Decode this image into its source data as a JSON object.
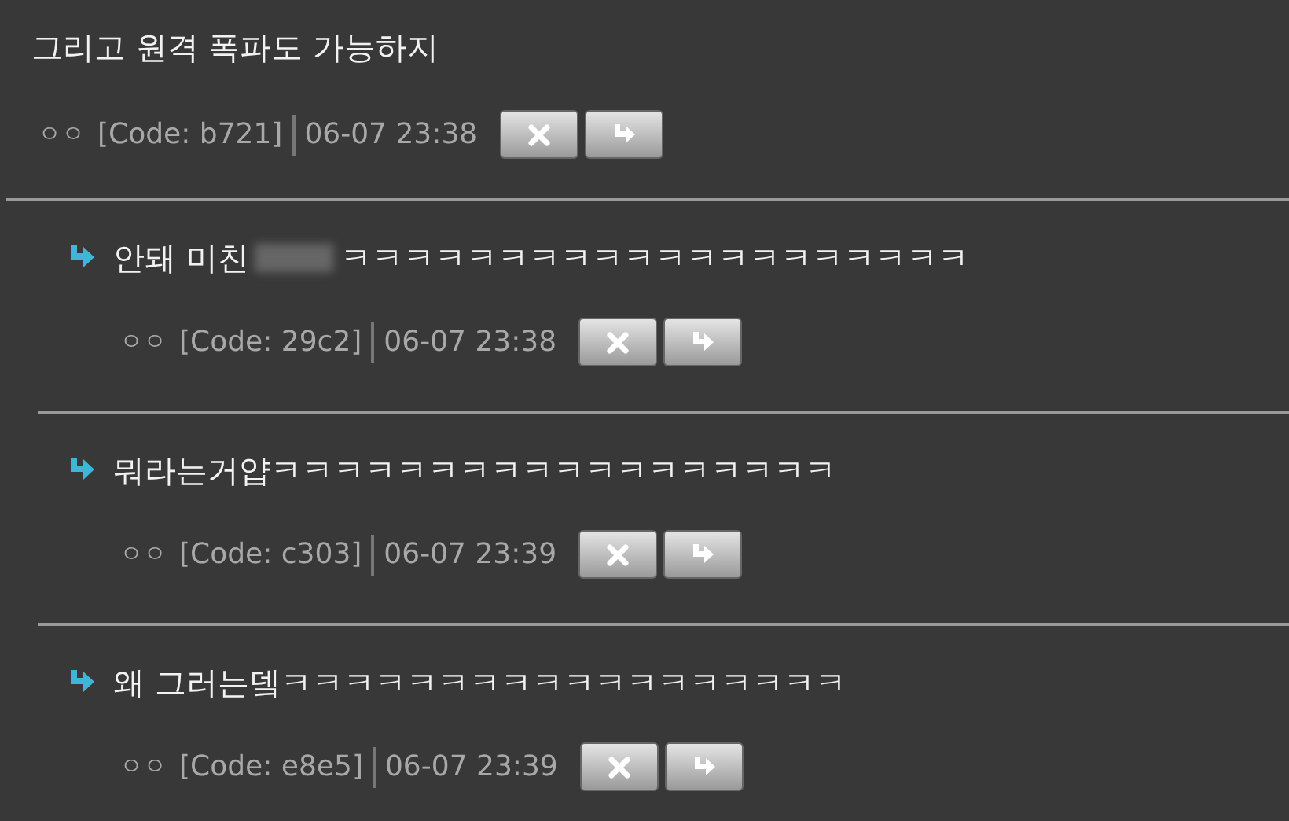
{
  "comment": {
    "text": "그리고 원격 폭파도 가능하지",
    "author": "ㅇㅇ",
    "code": "[Code: b721]",
    "time": "06-07 23:38"
  },
  "replies": [
    {
      "text_before": "안돼 미친",
      "censored": true,
      "text_after": "ㅋㅋㅋㅋㅋㅋㅋㅋㅋㅋㅋㅋㅋㅋㅋㅋㅋㅋㅋㅋ",
      "author": "ㅇㅇ",
      "code": "[Code: 29c2]",
      "time": "06-07 23:38"
    },
    {
      "text_before": "뭐라는거얍ㅋㅋㅋㅋㅋㅋㅋㅋㅋㅋㅋㅋㅋㅋㅋㅋㅋㅋ",
      "censored": false,
      "author": "ㅇㅇ",
      "code": "[Code: c303]",
      "time": "06-07 23:39"
    },
    {
      "text_before": "왜 그러는뎈ㅋㅋㅋㅋㅋㅋㅋㅋㅋㅋㅋㅋㅋㅋㅋㅋㅋㅋ",
      "censored": false,
      "author": "ㅇㅇ",
      "code": "[Code: e8e5]",
      "time": "06-07 23:39"
    }
  ]
}
